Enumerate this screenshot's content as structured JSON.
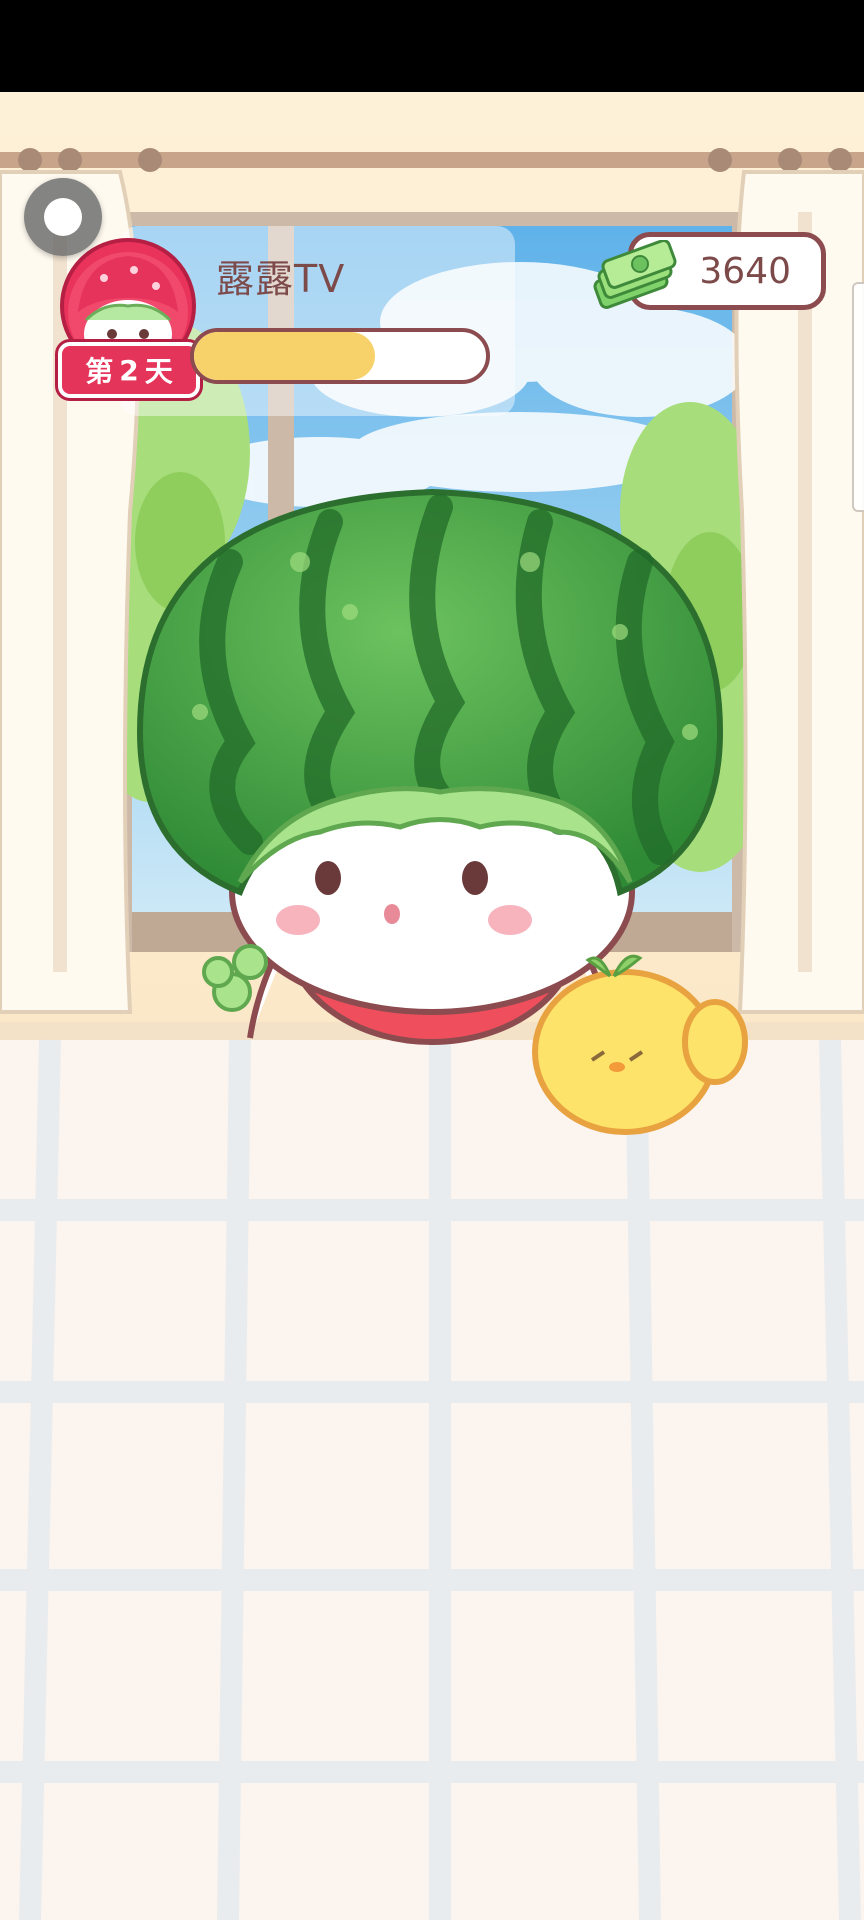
{
  "hud": {
    "player_name": "露露TV",
    "day_prefix": "第",
    "day_number": "2",
    "day_suffix": "天",
    "progress": 0.62,
    "currency_amount": "3640"
  },
  "icons": {
    "avatar": "strawberry-girl-avatar-icon",
    "currency": "cash-stack-icon",
    "floating_menu": "assistive-touch-icon"
  },
  "colors": {
    "progress_fill": "#f7d26b",
    "badge": "#e5345a",
    "text": "#7d4a4a",
    "outline": "#8c4b4f",
    "sky": "#9fd3f2",
    "watermelon": "#3f9a3f",
    "tile_grout": "#e2e6e9",
    "tile": "#fbf0ea"
  }
}
